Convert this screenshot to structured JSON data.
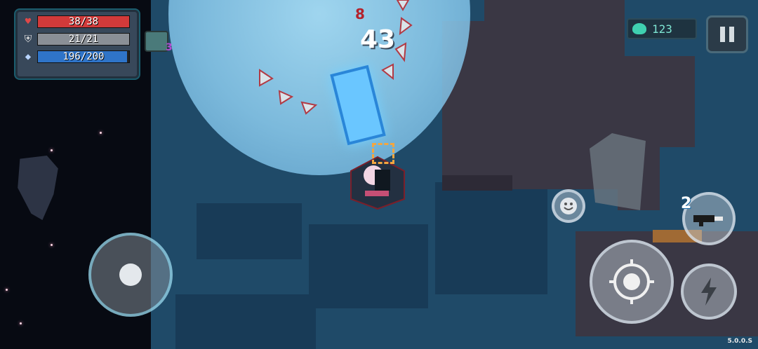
{
  "hud": {
    "health": {
      "text": "38/38",
      "fill": 1.0,
      "color": "#d23a3a"
    },
    "armor": {
      "text": "21/21",
      "fill": 1.0,
      "color": "#8a8f96"
    },
    "energy": {
      "text": "196/200",
      "fill": 0.98,
      "color": "#2f74c8"
    }
  },
  "pet": {
    "level": "3"
  },
  "combat": {
    "damage_big": "43",
    "damage_small": "8"
  },
  "currency": {
    "gems": "123",
    "icon": "gem-icon"
  },
  "skill": {
    "charges": "2"
  },
  "version": "5.0.0.S",
  "buttons": {
    "pause": "pause-icon",
    "emote": "smile-icon",
    "attack": "crosshair-icon",
    "skill": "lightning-icon",
    "weapon": "gun-icon"
  }
}
